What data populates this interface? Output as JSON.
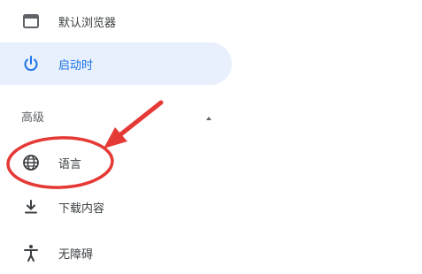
{
  "menu": {
    "default_browser_label": "默认浏览器",
    "on_startup_label": "启动时",
    "advanced_section_label": "高级",
    "language_label": "语言",
    "downloads_label": "下载内容",
    "accessibility_label": "无障碍"
  },
  "icons": {
    "default_browser": "browser-window-icon",
    "on_startup": "power-icon",
    "advanced_toggle": "caret-up-icon",
    "language": "globe-icon",
    "downloads": "download-icon",
    "accessibility": "accessibility-icon"
  },
  "colors": {
    "selected_bg": "#e8f0fe",
    "selected_fg": "#1a73e8",
    "text": "#3c4043",
    "icon": "#5f6368",
    "annotation_red": "#e53935"
  }
}
